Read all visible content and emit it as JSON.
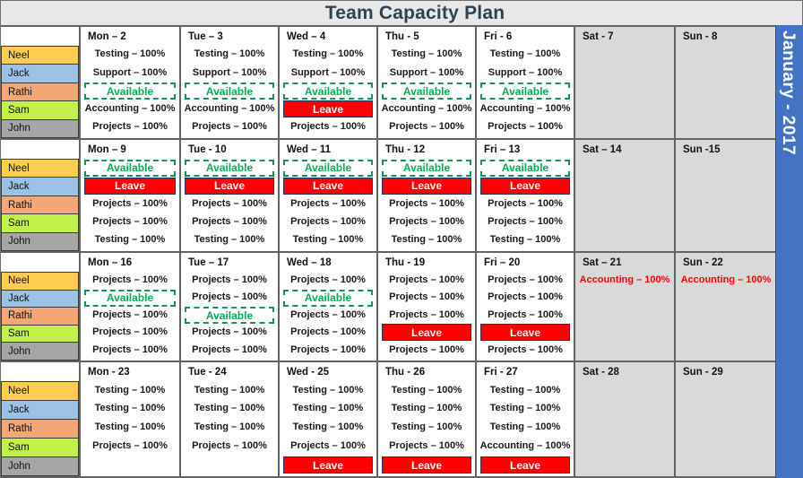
{
  "header": {
    "title": "Team Capacity Plan"
  },
  "rail": {
    "month_label": "January - 2017"
  },
  "colors": {
    "title_text": "#2f4157",
    "title_bg": "#e8e8e8",
    "rail_bg": "#4472c4",
    "weekend_bg": "#d9d9d9",
    "available_text": "#00b050",
    "available_border": "#14945a",
    "leave_bg": "#ff0000",
    "leave_border": "#1f3864",
    "weekend_task_text": "#ff0000"
  },
  "people": [
    {
      "name": "Neel",
      "color": "#ffcc52"
    },
    {
      "name": "Jack",
      "color": "#9cc3e5"
    },
    {
      "name": "Rathi",
      "color": "#f4a675"
    },
    {
      "name": "Sam",
      "color": "#c1f14a"
    },
    {
      "name": "John",
      "color": "#a6a6a6"
    }
  ],
  "labels": {
    "available": "Available",
    "leave": "Leave"
  },
  "weeks": [
    {
      "days": [
        {
          "head": "Mon – 2",
          "weekend": false,
          "slots": [
            {
              "type": "task",
              "text": "Testing – 100%"
            },
            {
              "type": "task",
              "text": "Support – 100%"
            },
            {
              "type": "available",
              "text": "Available"
            },
            {
              "type": "task",
              "text": "Accounting – 100%"
            },
            {
              "type": "task",
              "text": "Projects – 100%"
            }
          ]
        },
        {
          "head": "Tue – 3",
          "weekend": false,
          "slots": [
            {
              "type": "task",
              "text": "Testing – 100%"
            },
            {
              "type": "task",
              "text": "Support  – 100%"
            },
            {
              "type": "available",
              "text": "Available"
            },
            {
              "type": "task",
              "text": "Accounting – 100%"
            },
            {
              "type": "task",
              "text": "Projects – 100%"
            }
          ]
        },
        {
          "head": "Wed – 4",
          "weekend": false,
          "slots": [
            {
              "type": "task",
              "text": "Testing – 100%"
            },
            {
              "type": "task",
              "text": "Support – 100%"
            },
            {
              "type": "available",
              "text": "Available"
            },
            {
              "type": "leave",
              "text": "Leave"
            },
            {
              "type": "task",
              "text": "Projects – 100%"
            }
          ]
        },
        {
          "head": "Thu - 5",
          "weekend": false,
          "slots": [
            {
              "type": "task",
              "text": "Testing – 100%"
            },
            {
              "type": "task",
              "text": "Support – 100%"
            },
            {
              "type": "available",
              "text": "Available"
            },
            {
              "type": "task",
              "text": "Accounting – 100%"
            },
            {
              "type": "task",
              "text": "Projects – 100%"
            }
          ]
        },
        {
          "head": "Fri - 6",
          "weekend": false,
          "slots": [
            {
              "type": "task",
              "text": "Testing – 100%"
            },
            {
              "type": "task",
              "text": "Support – 100%"
            },
            {
              "type": "available",
              "text": "Available"
            },
            {
              "type": "task",
              "text": "Accounting – 100%"
            },
            {
              "type": "task",
              "text": "Projects – 100%"
            }
          ]
        },
        {
          "head": "Sat - 7",
          "weekend": true,
          "slots": []
        },
        {
          "head": "Sun - 8",
          "weekend": true,
          "slots": []
        }
      ]
    },
    {
      "days": [
        {
          "head": "Mon – 9",
          "weekend": false,
          "slots": [
            {
              "type": "available",
              "text": "Available"
            },
            {
              "type": "leave",
              "text": "Leave"
            },
            {
              "type": "task",
              "text": "Projects – 100%"
            },
            {
              "type": "task",
              "text": "Projects – 100%"
            },
            {
              "type": "task",
              "text": "Testing – 100%"
            }
          ]
        },
        {
          "head": "Tue - 10",
          "weekend": false,
          "slots": [
            {
              "type": "available",
              "text": "Available"
            },
            {
              "type": "leave",
              "text": "Leave"
            },
            {
              "type": "task",
              "text": "Projects – 100%"
            },
            {
              "type": "task",
              "text": "Projects – 100%"
            },
            {
              "type": "task",
              "text": "Testing – 100%"
            }
          ]
        },
        {
          "head": "Wed – 11",
          "weekend": false,
          "slots": [
            {
              "type": "available",
              "text": "Available"
            },
            {
              "type": "leave",
              "text": "Leave"
            },
            {
              "type": "task",
              "text": "Projects – 100%"
            },
            {
              "type": "task",
              "text": "Projects – 100%"
            },
            {
              "type": "task",
              "text": "Testing – 100%"
            }
          ]
        },
        {
          "head": "Thu - 12",
          "weekend": false,
          "slots": [
            {
              "type": "available",
              "text": "Available"
            },
            {
              "type": "leave",
              "text": "Leave"
            },
            {
              "type": "task",
              "text": "Projects – 100%"
            },
            {
              "type": "task",
              "text": "Projects – 100%"
            },
            {
              "type": "task",
              "text": "Testing – 100%"
            }
          ]
        },
        {
          "head": "Fri – 13",
          "weekend": false,
          "slots": [
            {
              "type": "available",
              "text": "Available"
            },
            {
              "type": "leave",
              "text": "Leave"
            },
            {
              "type": "task",
              "text": "Projects – 100%"
            },
            {
              "type": "task",
              "text": "Projects – 100%"
            },
            {
              "type": "task",
              "text": "Testing – 100%"
            }
          ]
        },
        {
          "head": "Sat – 14",
          "weekend": true,
          "slots": []
        },
        {
          "head": "Sun -15",
          "weekend": true,
          "slots": []
        }
      ]
    },
    {
      "days": [
        {
          "head": "Mon – 16",
          "weekend": false,
          "slots": [
            {
              "type": "task",
              "text": "Projects – 100%"
            },
            {
              "type": "available",
              "text": "Available"
            },
            {
              "type": "task",
              "text": "Projects – 100%"
            },
            {
              "type": "task",
              "text": "Projects – 100%"
            },
            {
              "type": "task",
              "text": "Projects – 100%"
            }
          ]
        },
        {
          "head": "Tue – 17",
          "weekend": false,
          "slots": [
            {
              "type": "task",
              "text": "Projects – 100%"
            },
            {
              "type": "task",
              "text": "Projects – 100%"
            },
            {
              "type": "available",
              "text": "Available"
            },
            {
              "type": "task",
              "text": "Projects – 100%"
            },
            {
              "type": "task",
              "text": "Projects – 100%"
            }
          ]
        },
        {
          "head": "Wed – 18",
          "weekend": false,
          "slots": [
            {
              "type": "task",
              "text": "Projects – 100%"
            },
            {
              "type": "available",
              "text": "Available"
            },
            {
              "type": "task",
              "text": "Projects – 100%"
            },
            {
              "type": "task",
              "text": "Projects – 100%"
            },
            {
              "type": "task",
              "text": "Projects – 100%"
            }
          ]
        },
        {
          "head": "Thu - 19",
          "weekend": false,
          "slots": [
            {
              "type": "task",
              "text": "Projects – 100%"
            },
            {
              "type": "task",
              "text": "Projects – 100%"
            },
            {
              "type": "task",
              "text": "Projects – 100%"
            },
            {
              "type": "leave",
              "text": "Leave"
            },
            {
              "type": "task",
              "text": "Projects – 100%"
            }
          ]
        },
        {
          "head": "Fri – 20",
          "weekend": false,
          "slots": [
            {
              "type": "task",
              "text": "Projects – 100%"
            },
            {
              "type": "task",
              "text": "Projects – 100%"
            },
            {
              "type": "task",
              "text": "Projects – 100%"
            },
            {
              "type": "leave",
              "text": "Leave"
            },
            {
              "type": "task",
              "text": "Projects – 100%"
            }
          ]
        },
        {
          "head": "Sat – 21",
          "weekend": true,
          "slots": [
            {
              "type": "weekend-task",
              "text": "Accounting – 100%"
            },
            {
              "type": "blank",
              "text": ""
            },
            {
              "type": "blank",
              "text": ""
            },
            {
              "type": "blank",
              "text": ""
            },
            {
              "type": "blank",
              "text": ""
            }
          ]
        },
        {
          "head": "Sun - 22",
          "weekend": true,
          "slots": [
            {
              "type": "weekend-task",
              "text": "Accounting – 100%"
            },
            {
              "type": "blank",
              "text": ""
            },
            {
              "type": "blank",
              "text": ""
            },
            {
              "type": "blank",
              "text": ""
            },
            {
              "type": "blank",
              "text": ""
            }
          ]
        }
      ]
    },
    {
      "days": [
        {
          "head": "Mon - 23",
          "weekend": false,
          "slots": [
            {
              "type": "task",
              "text": "Testing – 100%"
            },
            {
              "type": "task",
              "text": "Testing – 100%"
            },
            {
              "type": "task",
              "text": "Testing – 100%"
            },
            {
              "type": "task",
              "text": "Projects – 100%"
            },
            {
              "type": "blank",
              "text": ""
            }
          ]
        },
        {
          "head": "Tue - 24",
          "weekend": false,
          "slots": [
            {
              "type": "task",
              "text": "Testing – 100%"
            },
            {
              "type": "task",
              "text": "Testing – 100%"
            },
            {
              "type": "task",
              "text": "Testing – 100%"
            },
            {
              "type": "task",
              "text": "Projects – 100%"
            },
            {
              "type": "blank",
              "text": ""
            }
          ]
        },
        {
          "head": "Wed - 25",
          "weekend": false,
          "slots": [
            {
              "type": "task",
              "text": "Testing – 100%"
            },
            {
              "type": "task",
              "text": "Testing – 100%"
            },
            {
              "type": "task",
              "text": "Testing – 100%"
            },
            {
              "type": "task",
              "text": "Projects – 100%"
            },
            {
              "type": "leave",
              "text": "Leave"
            }
          ]
        },
        {
          "head": "Thu - 26",
          "weekend": false,
          "slots": [
            {
              "type": "task",
              "text": "Testing – 100%"
            },
            {
              "type": "task",
              "text": "Testing – 100%"
            },
            {
              "type": "task",
              "text": "Testing – 100%"
            },
            {
              "type": "task",
              "text": "Projects – 100%"
            },
            {
              "type": "leave",
              "text": "Leave"
            }
          ]
        },
        {
          "head": "Fri - 27",
          "weekend": false,
          "slots": [
            {
              "type": "task",
              "text": "Testing – 100%"
            },
            {
              "type": "task",
              "text": "Testing – 100%"
            },
            {
              "type": "task",
              "text": "Testing – 100%"
            },
            {
              "type": "task",
              "text": "Accounting – 100%"
            },
            {
              "type": "leave",
              "text": "Leave"
            }
          ]
        },
        {
          "head": "Sat - 28",
          "weekend": true,
          "slots": []
        },
        {
          "head": "Sun - 29",
          "weekend": true,
          "slots": []
        }
      ]
    }
  ]
}
